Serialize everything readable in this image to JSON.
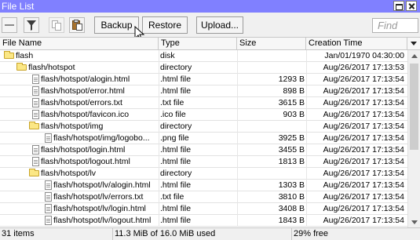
{
  "window": {
    "title": "File List"
  },
  "toolbar": {
    "backup_label": "Backup",
    "restore_label": "Restore",
    "upload_label": "Upload...",
    "search_placeholder": "Find",
    "icons": [
      "minus-icon",
      "filter-icon",
      "copy-icon",
      "paste-icon"
    ]
  },
  "columns": {
    "name": "File Name",
    "type": "Type",
    "size": "Size",
    "time": "Creation Time"
  },
  "rows": [
    {
      "name": "flash",
      "type": "disk",
      "size": "",
      "time": "Jan/01/1970 04:30:00",
      "icon": "folder-icon",
      "level": 0
    },
    {
      "name": "flash/hotspot",
      "type": "directory",
      "size": "",
      "time": "Aug/26/2017 17:13:53",
      "icon": "folder-icon",
      "level": 1
    },
    {
      "name": "flash/hotspot/alogin.html",
      "type": ".html file",
      "size": "1293 B",
      "time": "Aug/26/2017 17:13:54",
      "icon": "file-icon",
      "level": 2
    },
    {
      "name": "flash/hotspot/error.html",
      "type": ".html file",
      "size": "898 B",
      "time": "Aug/26/2017 17:13:54",
      "icon": "file-icon",
      "level": 2
    },
    {
      "name": "flash/hotspot/errors.txt",
      "type": ".txt file",
      "size": "3615 B",
      "time": "Aug/26/2017 17:13:54",
      "icon": "file-icon",
      "level": 2
    },
    {
      "name": "flash/hotspot/favicon.ico",
      "type": ".ico file",
      "size": "903 B",
      "time": "Aug/26/2017 17:13:54",
      "icon": "file-icon",
      "level": 2
    },
    {
      "name": "flash/hotspot/img",
      "type": "directory",
      "size": "",
      "time": "Aug/26/2017 17:13:54",
      "icon": "folder-icon",
      "level": 2
    },
    {
      "name": "flash/hotspot/img/logobo...",
      "type": ".png file",
      "size": "3925 B",
      "time": "Aug/26/2017 17:13:54",
      "icon": "file-icon",
      "level": 3
    },
    {
      "name": "flash/hotspot/login.html",
      "type": ".html file",
      "size": "3455 B",
      "time": "Aug/26/2017 17:13:54",
      "icon": "file-icon",
      "level": 2
    },
    {
      "name": "flash/hotspot/logout.html",
      "type": ".html file",
      "size": "1813 B",
      "time": "Aug/26/2017 17:13:54",
      "icon": "file-icon",
      "level": 2
    },
    {
      "name": "flash/hotspot/lv",
      "type": "directory",
      "size": "",
      "time": "Aug/26/2017 17:13:54",
      "icon": "folder-icon",
      "level": 2
    },
    {
      "name": "flash/hotspot/lv/alogin.html",
      "type": ".html file",
      "size": "1303 B",
      "time": "Aug/26/2017 17:13:54",
      "icon": "file-icon",
      "level": 3
    },
    {
      "name": "flash/hotspot/lv/errors.txt",
      "type": ".txt file",
      "size": "3810 B",
      "time": "Aug/26/2017 17:13:54",
      "icon": "file-icon",
      "level": 3
    },
    {
      "name": "flash/hotspot/lv/login.html",
      "type": ".html file",
      "size": "3408 B",
      "time": "Aug/26/2017 17:13:54",
      "icon": "file-icon",
      "level": 3
    },
    {
      "name": "flash/hotspot/lv/logout.html",
      "type": ".html file",
      "size": "1843 B",
      "time": "Aug/26/2017 17:13:54",
      "icon": "file-icon",
      "level": 3
    }
  ],
  "status": {
    "items": "31 items",
    "usage": "11.3 MiB of 16.0 MiB used",
    "free": "29% free"
  },
  "colors": {
    "titlebar": "#8080ff",
    "folder": "#fbe785",
    "background": "#f0f0f0"
  }
}
